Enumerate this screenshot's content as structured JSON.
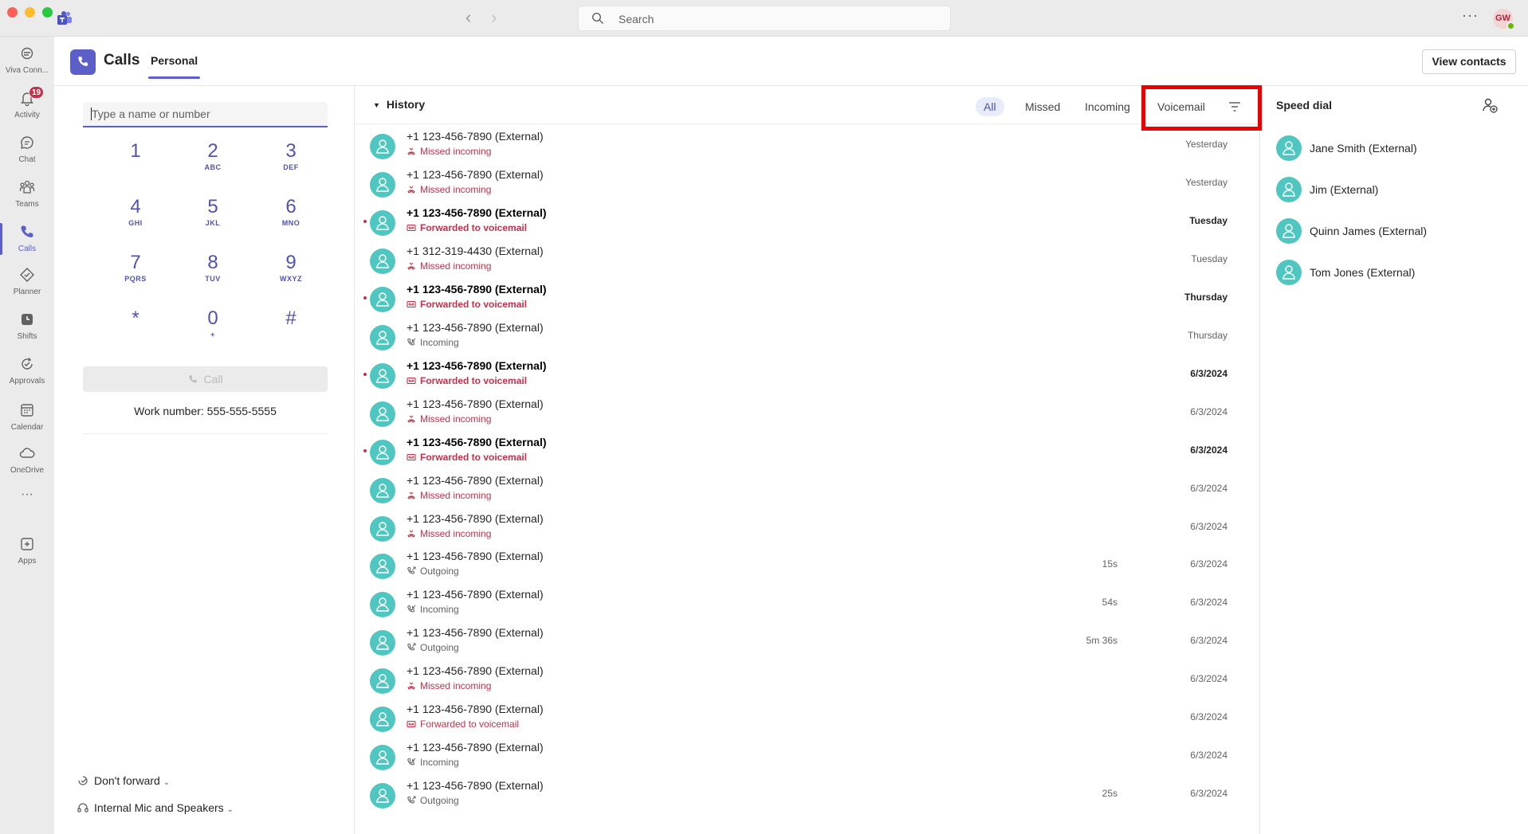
{
  "titlebar": {
    "search_placeholder": "Search",
    "more_label": "···",
    "user_initials": "GW"
  },
  "rail": {
    "items": [
      {
        "label": "Viva Conn...",
        "icon": "viva-connections-icon"
      },
      {
        "label": "Activity",
        "icon": "bell-icon",
        "badge": "19"
      },
      {
        "label": "Chat",
        "icon": "chat-icon"
      },
      {
        "label": "Teams",
        "icon": "teams-icon"
      },
      {
        "label": "Calls",
        "icon": "phone-icon",
        "active": true
      },
      {
        "label": "Planner",
        "icon": "planner-icon"
      },
      {
        "label": "Shifts",
        "icon": "shifts-icon"
      },
      {
        "label": "Approvals",
        "icon": "approvals-icon"
      },
      {
        "label": "Calendar",
        "icon": "calendar-icon"
      },
      {
        "label": "OneDrive",
        "icon": "cloud-icon"
      },
      {
        "label": "···",
        "icon": "more-apps-icon"
      },
      {
        "label": "Apps",
        "icon": "add-apps-icon"
      }
    ]
  },
  "header": {
    "title": "Calls",
    "tab": "Personal",
    "view_contacts": "View contacts"
  },
  "dialer": {
    "placeholder": "Type a name or number",
    "keys": [
      {
        "num": "1",
        "sub": ""
      },
      {
        "num": "2",
        "sub": "ABC"
      },
      {
        "num": "3",
        "sub": "DEF"
      },
      {
        "num": "4",
        "sub": "GHI"
      },
      {
        "num": "5",
        "sub": "JKL"
      },
      {
        "num": "6",
        "sub": "MNO"
      },
      {
        "num": "7",
        "sub": "PQRS"
      },
      {
        "num": "8",
        "sub": "TUV"
      },
      {
        "num": "9",
        "sub": "WXYZ"
      },
      {
        "num": "*",
        "sub": ""
      },
      {
        "num": "0",
        "sub": "+"
      },
      {
        "num": "#",
        "sub": ""
      }
    ],
    "call_label": "Call",
    "work_number": "Work number:  555-555-5555",
    "forward_label": "Don't forward",
    "audio_label": "Internal Mic and Speakers"
  },
  "history": {
    "title": "History",
    "filters": {
      "all": "All",
      "missed": "Missed",
      "incoming": "Incoming",
      "voicemail": "Voicemail"
    },
    "rows": [
      {
        "name": "+1 123-456-7890 (External)",
        "status": "Missed incoming",
        "type": "missed",
        "duration": "",
        "date": "Yesterday",
        "unread": false
      },
      {
        "name": "+1 123-456-7890 (External)",
        "status": "Missed incoming",
        "type": "missed",
        "duration": "",
        "date": "Yesterday",
        "unread": false
      },
      {
        "name": "+1 123-456-7890 (External)",
        "status": "Forwarded to voicemail",
        "type": "voicemail",
        "duration": "",
        "date": "Tuesday",
        "unread": true
      },
      {
        "name": "+1 312-319-4430 (External)",
        "status": "Missed incoming",
        "type": "missed",
        "duration": "",
        "date": "Tuesday",
        "unread": false
      },
      {
        "name": "+1 123-456-7890 (External)",
        "status": "Forwarded to voicemail",
        "type": "voicemail",
        "duration": "",
        "date": "Thursday",
        "unread": true
      },
      {
        "name": "+1 123-456-7890 (External)",
        "status": "Incoming",
        "type": "incoming",
        "duration": "",
        "date": "Thursday",
        "unread": false
      },
      {
        "name": "+1 123-456-7890 (External)",
        "status": "Forwarded to voicemail",
        "type": "voicemail",
        "duration": "",
        "date": "6/3/2024",
        "unread": true
      },
      {
        "name": "+1 123-456-7890 (External)",
        "status": "Missed incoming",
        "type": "missed",
        "duration": "",
        "date": "6/3/2024",
        "unread": false
      },
      {
        "name": "+1 123-456-7890 (External)",
        "status": "Forwarded to voicemail",
        "type": "voicemail",
        "duration": "",
        "date": "6/3/2024",
        "unread": true
      },
      {
        "name": "+1 123-456-7890 (External)",
        "status": "Missed incoming",
        "type": "missed",
        "duration": "",
        "date": "6/3/2024",
        "unread": false
      },
      {
        "name": "+1 123-456-7890 (External)",
        "status": "Missed incoming",
        "type": "missed",
        "duration": "",
        "date": "6/3/2024",
        "unread": false
      },
      {
        "name": "+1 123-456-7890 (External)",
        "status": "Outgoing",
        "type": "outgoing",
        "duration": "15s",
        "date": "6/3/2024",
        "unread": false
      },
      {
        "name": "+1 123-456-7890 (External)",
        "status": "Incoming",
        "type": "incoming",
        "duration": "54s",
        "date": "6/3/2024",
        "unread": false
      },
      {
        "name": "+1 123-456-7890 (External)",
        "status": "Outgoing",
        "type": "outgoing",
        "duration": "5m 36s",
        "date": "6/3/2024",
        "unread": false
      },
      {
        "name": "+1 123-456-7890 (External)",
        "status": "Missed incoming",
        "type": "missed",
        "duration": "",
        "date": "6/3/2024",
        "unread": false
      },
      {
        "name": "+1 123-456-7890 (External)",
        "status": "Forwarded to voicemail",
        "type": "voicemail",
        "duration": "",
        "date": "6/3/2024",
        "unread": false
      },
      {
        "name": "+1 123-456-7890 (External)",
        "status": "Incoming",
        "type": "incoming",
        "duration": "",
        "date": "6/3/2024",
        "unread": false
      },
      {
        "name": "+1 123-456-7890 (External)",
        "status": "Outgoing",
        "type": "outgoing",
        "duration": "25s",
        "date": "6/3/2024",
        "unread": false
      }
    ]
  },
  "speed_dial": {
    "title": "Speed dial",
    "contacts": [
      "Jane Smith (External)",
      "Jim (External)",
      "Quinn James (External)",
      "Tom Jones (External)"
    ]
  },
  "colors": {
    "accent": "#5b5fc7",
    "missed": "#c4314b",
    "avatar": "#4fc7c0",
    "highlight": "#ee0000"
  }
}
